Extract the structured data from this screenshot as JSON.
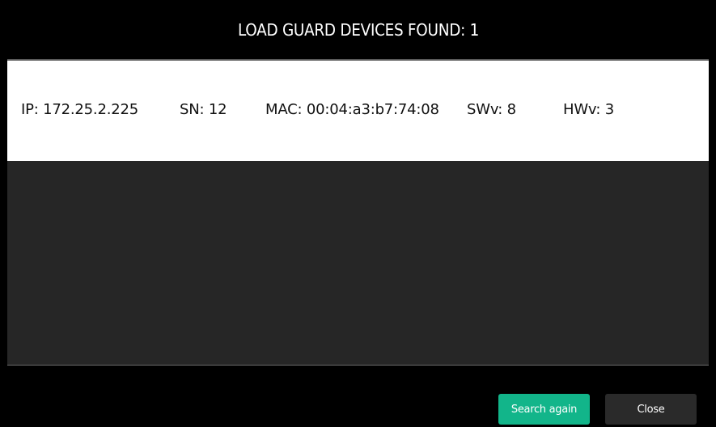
{
  "header": {
    "title": "LOAD GUARD DEVICES FOUND: 1"
  },
  "devices": [
    {
      "ip": "IP: 172.25.2.225",
      "sn": "SN: 12",
      "mac": "MAC: 00:04:a3:b7:74:08",
      "swv": "SWv: 8",
      "hwv": "HWv: 3"
    }
  ],
  "footer": {
    "search_again_label": "Search again",
    "close_label": "Close"
  },
  "colors": {
    "accent": "#12b58a",
    "background": "#000000",
    "list_background": "#262626",
    "row_background": "#ffffff"
  }
}
